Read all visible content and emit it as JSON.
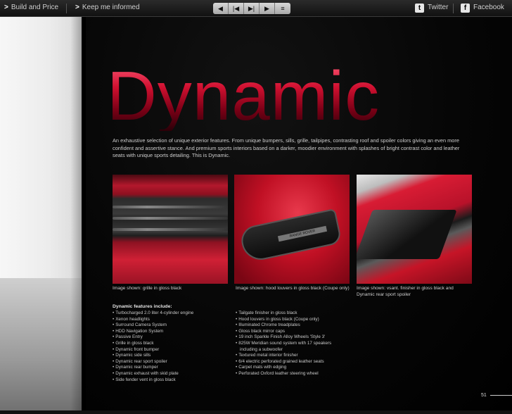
{
  "toolbar": {
    "build_price": "Build and Price",
    "keep_informed": "Keep me informed",
    "twitter": "Twitter",
    "facebook": "Facebook",
    "arrow_glyph": ">"
  },
  "nav": {
    "prev": "◀",
    "first": "|◀",
    "next": "▶|",
    "last": "▶",
    "menu": "≡"
  },
  "headline": "Dynamic",
  "intro": "An exhaustive selection of unique exterior features. From unique bumpers, sills, grille, tailpipes, contrasting roof and spoiler colors giving an even more confident and assertive stance. And premium sports interiors based on a darker, moodier environment with splashes of bright contrast color and leather seats with unique sports detailing. This is Dynamic.",
  "photos": {
    "grille_caption": "Image shown: grille in gloss black",
    "louver_caption": "Image shown: hood louvers in gloss black (Coupe only)",
    "louver_badge": "RANGE ROVER",
    "spoiler_caption": "Image shown: vsant. finisher in gloss black and Dynamic rear sport spoiler"
  },
  "features": {
    "title": "Dynamic features include:",
    "left": [
      "Turbocharged 2.0 liter 4-cylinder engine",
      "Xenon headlights",
      "Surround Camera System",
      "HDD Navigation System",
      "Passive Entry",
      "Grille in gloss black",
      "Dynamic front bumper",
      "Dynamic side sills",
      "Dynamic rear sport spoiler",
      "Dynamic rear bumper",
      "Dynamic exhaust with skid plate",
      "Side fender vent in gloss black"
    ],
    "right": [
      "Tailgate finisher in gloss black",
      "Hood louvers in gloss black (Coupe only)",
      "Illuminated Chrome treadplates",
      "Gloss black mirror caps",
      "19 inch Sparkle Finish Alloy Wheels 'Style 3'",
      "825W Meridian sound system with 17 speakers",
      "including a subwoofer",
      "Textured metal interior finisher",
      "6/4 electric perforated grained leather seats",
      "Carpet mats with edging",
      "Perforated Oxford leather steering wheel"
    ]
  },
  "page_number": "51",
  "colors": {
    "accent_red": "#d01030",
    "toolbar_dark": "#1a1a1a",
    "background": "#000000"
  }
}
